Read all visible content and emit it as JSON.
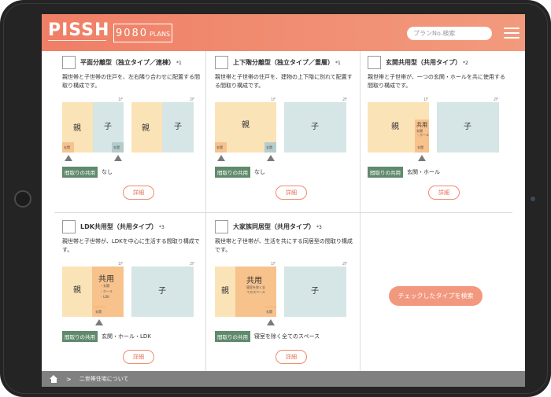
{
  "header": {
    "logo": "PISSH",
    "plans_number": "9080",
    "plans_word": "PLANS",
    "search_placeholder": "プランNo.検索"
  },
  "colors": {
    "header": "#ef7f66",
    "parent_block": "#fbe3b8",
    "child_block": "#d6e5e5",
    "shared_block": "#f7c28c",
    "entrance_parent": "#f7c28c",
    "entrance_child": "#b5cccc",
    "badge": "#5f8a6b",
    "button_accent": "#ef8a70"
  },
  "labels": {
    "oya": "親",
    "ko": "子",
    "floor1": "1F",
    "floor2": "2F",
    "genkan": "玄関",
    "shared_badge": "間取りの共用",
    "detail": "詳細",
    "kyoyo": "共用"
  },
  "cards": [
    {
      "title": "平面分離型（独立タイプ／連棟）",
      "note": "*1",
      "desc": "親世帯と子世帯の住戸を、左右隣り合わせに配置する間取り構成です。",
      "shared_value": "なし"
    },
    {
      "title": "上下階分離型（独立タイプ／重層）",
      "note": "*1",
      "desc": "親世帯と子世帯の住戸を、建物の上下階に別れて配置する間取り構成です。",
      "shared_value": "なし"
    },
    {
      "title": "玄関共用型（共用タイプ）",
      "note": "*2",
      "desc": "親世帯と子世帯が、一つの玄関・ホールを共に使用する間取り構成です。",
      "shared_value": "玄関・ホール",
      "diagram_shared_text": "玄関\n・ホール"
    },
    {
      "title": "LDK共用型（共用タイプ）",
      "note": "*3",
      "desc": "親世帯と子世帯が、LDKを中心に生活する間取り構成です。",
      "shared_value": "玄関・ホール・LDK",
      "diagram_shared_items": [
        "・玄関",
        "・ホール",
        "・LDK"
      ]
    },
    {
      "title": "大家族同居型（共用タイプ）",
      "note": "*3",
      "desc": "親世帯と子世帯が、生活を共にする同居型の間取り構成です。",
      "shared_value": "寝室を除く全てのスペース",
      "diagram_shared_text": "寝室を除く全てのスペース"
    }
  ],
  "search_type_button": "チェックしたタイプを検索",
  "breadcrumb": {
    "separator": ">",
    "current": "二世帯住宅について"
  }
}
